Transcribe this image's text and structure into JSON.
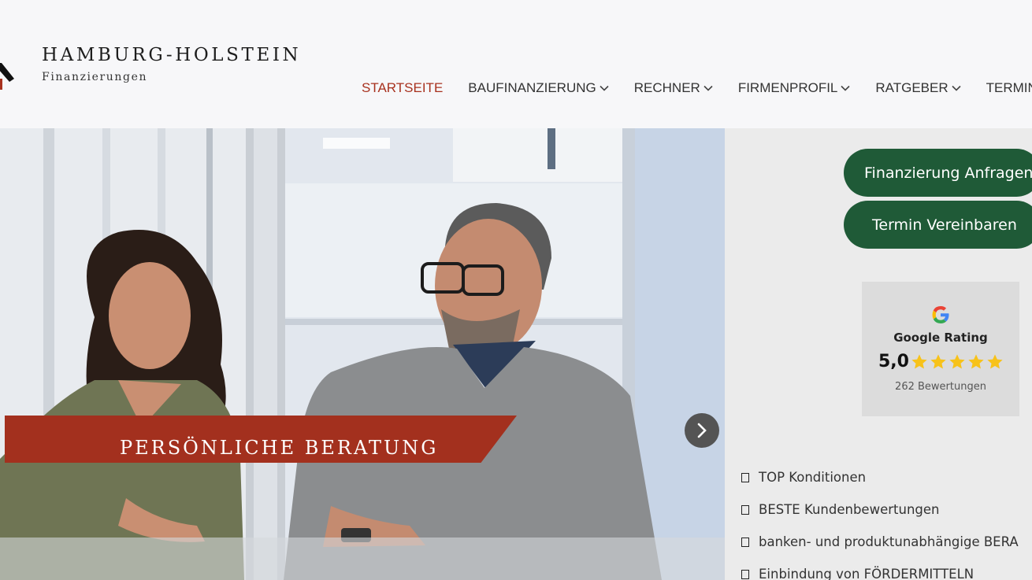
{
  "brand": {
    "name": "HAMBURG-HOLSTEIN",
    "subtitle": "Finanzierungen",
    "accent_color": "#a8321f"
  },
  "nav": {
    "items": [
      {
        "label": "STARTSEITE",
        "active": true,
        "has_dropdown": false
      },
      {
        "label": "BAUFINANZIERUNG",
        "active": false,
        "has_dropdown": true
      },
      {
        "label": "RECHNER",
        "active": false,
        "has_dropdown": true
      },
      {
        "label": "FIRMENPROFIL",
        "active": false,
        "has_dropdown": true
      },
      {
        "label": "RATGEBER",
        "active": false,
        "has_dropdown": true
      },
      {
        "label": "TERMIN VERE",
        "active": false,
        "has_dropdown": false
      }
    ]
  },
  "hero": {
    "banner_text": "PERSÖNLICHE BERATUNG",
    "banner_color": "#a3301e",
    "next_arrow_icon": "chevron-right-icon"
  },
  "sidebar": {
    "cta_primary": "Finanzierung Anfragen",
    "cta_secondary": "Termin Vereinbaren",
    "cta_color": "#1f5a37",
    "rating": {
      "title": "Google Rating",
      "score": "5,0",
      "stars": 5,
      "count_label": "262 Bewertungen",
      "logo_icon": "google-g-icon",
      "star_color": "#f7c21a"
    },
    "features": [
      "TOP Konditionen",
      "BESTE Kundenbewertungen",
      "banken- und produktunabhängige BERA",
      "Einbindung von FÖRDERMITTELN"
    ]
  }
}
